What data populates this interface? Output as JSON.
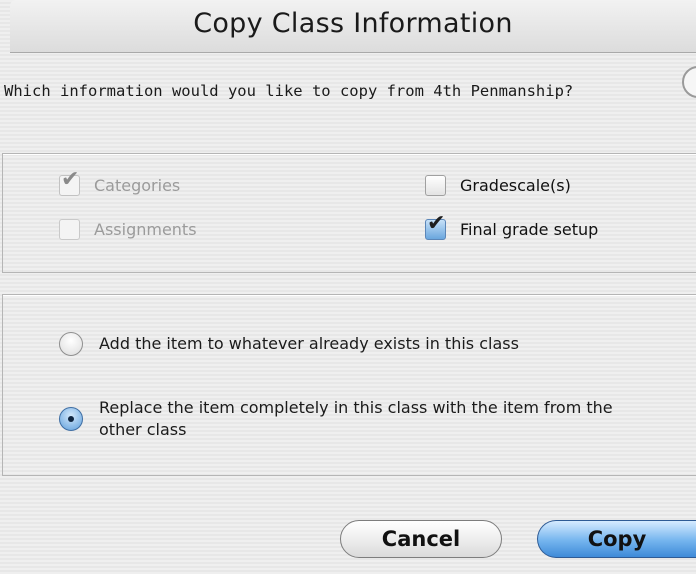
{
  "dialog": {
    "title": "Copy Class Information",
    "question": "Which information would you like to copy from 4th Penmanship?"
  },
  "options": [
    {
      "label": "Categories",
      "checked": true,
      "enabled": false
    },
    {
      "label": "Gradescale(s)",
      "checked": false,
      "enabled": true
    },
    {
      "label": "Assignments",
      "checked": false,
      "enabled": false
    },
    {
      "label": "Final grade setup",
      "checked": true,
      "enabled": true
    }
  ],
  "modes": [
    {
      "label": "Add the item to whatever already exists in this class",
      "selected": false
    },
    {
      "label": "Replace the item completely in this class with the item from the other class",
      "selected": true
    }
  ],
  "buttons": {
    "cancel": "Cancel",
    "copy": "Copy"
  },
  "icons": {
    "check": "✔"
  },
  "colors": {
    "accent": "#4a90d9",
    "background": "#ececec"
  }
}
